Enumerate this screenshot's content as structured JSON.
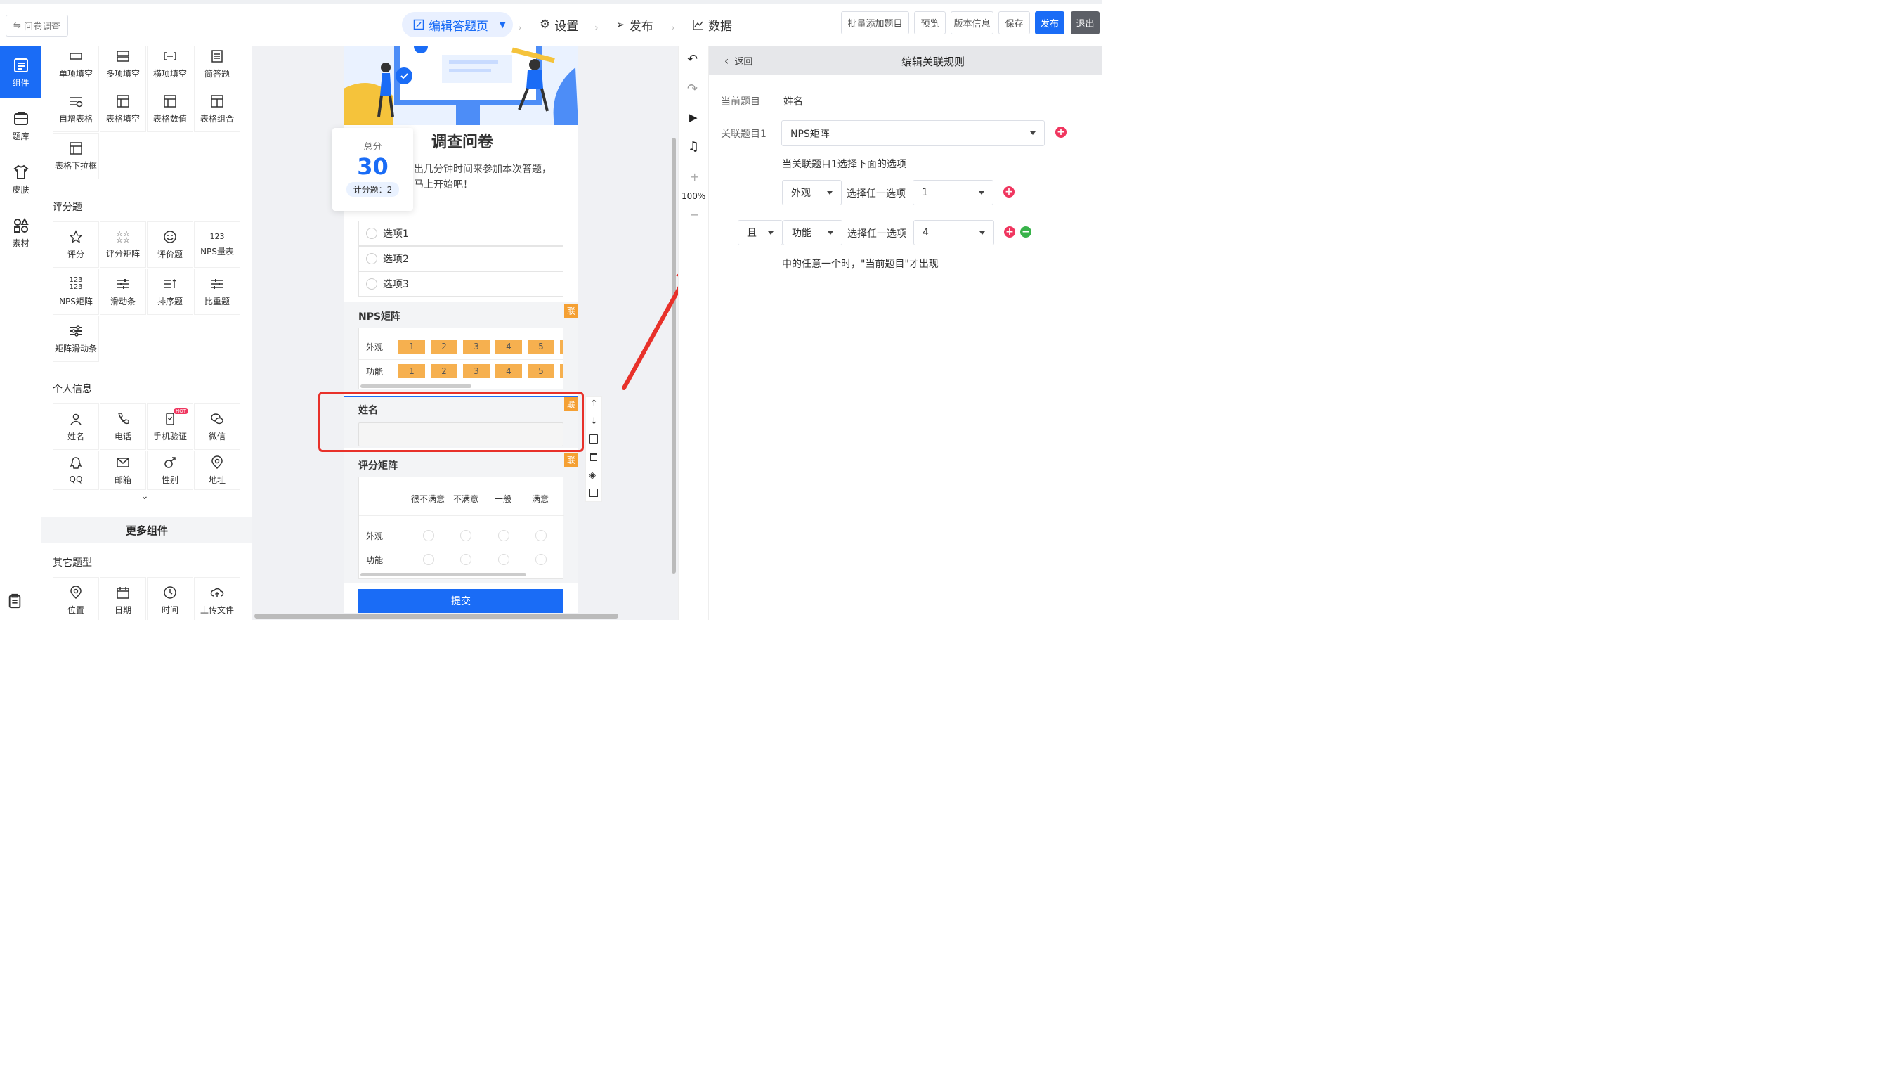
{
  "header": {
    "back_label": "问卷调查",
    "nav": [
      "编辑答题页",
      "设置",
      "发布",
      "数据"
    ],
    "buttons": [
      "批量添加题目",
      "预览",
      "版本信息",
      "保存",
      "发布",
      "退出"
    ]
  },
  "rail": [
    "组件",
    "题库",
    "皮肤",
    "素材"
  ],
  "panel": {
    "row1": [
      "单项填空",
      "多项填空",
      "横项填空",
      "简答题"
    ],
    "row2": [
      "自增表格",
      "表格填空",
      "表格数值",
      "表格组合"
    ],
    "row3": [
      "表格下拉框"
    ],
    "sec_score": "评分题",
    "score1": [
      "评分",
      "评分矩阵",
      "评价题",
      "NPS量表"
    ],
    "score2": [
      "NPS矩阵",
      "滑动条",
      "排序题",
      "比重题"
    ],
    "score3": [
      "矩阵滑动条"
    ],
    "sec_personal": "个人信息",
    "pers1": [
      "姓名",
      "电话",
      "手机验证",
      "微信"
    ],
    "hot": "HOT",
    "pers2": [
      "QQ",
      "邮箱",
      "性别",
      "地址"
    ],
    "more": "更多组件",
    "sec_other": "其它题型",
    "other": [
      "位置",
      "日期",
      "时间",
      "上传文件"
    ]
  },
  "survey": {
    "score_label": "总分",
    "score_value": "30",
    "score_count": "计分题：2",
    "title": "调查问卷",
    "intro1": "出几分钟时间来参加本次答题，",
    "intro2": "马上开始吧！",
    "options": [
      "选项1",
      "选项2",
      "选项3"
    ],
    "nps_title": "NPS矩阵",
    "nps_rows": [
      "外观",
      "功能"
    ],
    "nps_cols": [
      "1",
      "2",
      "3",
      "4",
      "5"
    ],
    "lian": "联",
    "name_title": "姓名",
    "rating_title": "评分矩阵",
    "rating_cols": [
      "很不满意",
      "不满意",
      "一般",
      "满意"
    ],
    "rating_rows": [
      "外观",
      "功能"
    ],
    "submit": "提交"
  },
  "tools": {
    "zoom": "100%"
  },
  "rule": {
    "back": "返回",
    "title": "编辑关联规则",
    "current_label": "当前题目",
    "current_value": "姓名",
    "related_label": "关联题目1",
    "related_value": "NPS矩阵",
    "hint": "当关联题目1选择下面的选项",
    "c1_item": "外观",
    "c1_op": "选择任一选项",
    "c1_val": "1",
    "c2_join": "且",
    "c2_item": "功能",
    "c2_op": "选择任一选项",
    "c2_val": "4",
    "footer": "中的任意一个时，\"当前题目\"才出现"
  },
  "colors": {
    "accent": "#1a6cf6",
    "highlight": "#e8312a",
    "orange": "#f6b04f",
    "pink": "#f0365f",
    "green": "#38b34a"
  }
}
